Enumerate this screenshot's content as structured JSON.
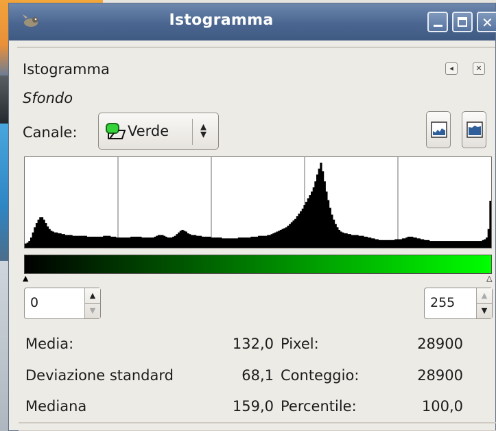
{
  "window": {
    "title": "Istogramma",
    "controls": {
      "minimize": "_",
      "maximize": "□",
      "close": "✕"
    }
  },
  "panel": {
    "title": "Istogramma",
    "layer_name": "Sfondo",
    "channel_label": "Canale:",
    "channel_value": "Verde",
    "channel_icon": "green-channel-icon",
    "mode_buttons": [
      "linear-histogram-icon",
      "logarithmic-histogram-icon"
    ]
  },
  "chart_data": {
    "type": "area",
    "x_range": [
      0,
      255
    ],
    "bins": 256,
    "values": [
      0.05,
      0.06,
      0.08,
      0.12,
      0.18,
      0.24,
      0.29,
      0.33,
      0.36,
      0.36,
      0.33,
      0.29,
      0.25,
      0.22,
      0.2,
      0.19,
      0.18,
      0.18,
      0.17,
      0.17,
      0.16,
      0.16,
      0.15,
      0.15,
      0.15,
      0.15,
      0.14,
      0.14,
      0.14,
      0.14,
      0.14,
      0.14,
      0.14,
      0.14,
      0.13,
      0.13,
      0.13,
      0.13,
      0.13,
      0.13,
      0.13,
      0.13,
      0.13,
      0.14,
      0.14,
      0.14,
      0.14,
      0.13,
      0.13,
      0.13,
      0.12,
      0.12,
      0.12,
      0.12,
      0.12,
      0.12,
      0.12,
      0.12,
      0.13,
      0.13,
      0.13,
      0.13,
      0.13,
      0.13,
      0.12,
      0.12,
      0.12,
      0.12,
      0.12,
      0.12,
      0.12,
      0.13,
      0.14,
      0.15,
      0.15,
      0.15,
      0.14,
      0.13,
      0.12,
      0.12,
      0.12,
      0.13,
      0.14,
      0.16,
      0.18,
      0.2,
      0.21,
      0.2,
      0.19,
      0.17,
      0.16,
      0.15,
      0.15,
      0.15,
      0.14,
      0.14,
      0.14,
      0.13,
      0.13,
      0.13,
      0.13,
      0.13,
      0.12,
      0.12,
      0.12,
      0.12,
      0.12,
      0.12,
      0.11,
      0.11,
      0.11,
      0.11,
      0.11,
      0.11,
      0.11,
      0.11,
      0.11,
      0.12,
      0.12,
      0.12,
      0.12,
      0.12,
      0.12,
      0.12,
      0.13,
      0.13,
      0.13,
      0.13,
      0.14,
      0.14,
      0.14,
      0.14,
      0.14,
      0.15,
      0.15,
      0.16,
      0.17,
      0.18,
      0.19,
      0.2,
      0.21,
      0.22,
      0.23,
      0.24,
      0.26,
      0.28,
      0.3,
      0.32,
      0.34,
      0.37,
      0.4,
      0.43,
      0.46,
      0.5,
      0.54,
      0.58,
      0.62,
      0.66,
      0.71,
      0.78,
      0.86,
      0.93,
      1.0,
      0.9,
      0.78,
      0.66,
      0.56,
      0.47,
      0.39,
      0.33,
      0.28,
      0.24,
      0.21,
      0.19,
      0.18,
      0.17,
      0.17,
      0.16,
      0.16,
      0.15,
      0.15,
      0.15,
      0.15,
      0.14,
      0.14,
      0.14,
      0.13,
      0.13,
      0.12,
      0.12,
      0.11,
      0.11,
      0.1,
      0.1,
      0.09,
      0.09,
      0.09,
      0.09,
      0.09,
      0.09,
      0.09,
      0.09,
      0.09,
      0.1,
      0.1,
      0.1,
      0.1,
      0.11,
      0.11,
      0.12,
      0.13,
      0.13,
      0.13,
      0.12,
      0.12,
      0.11,
      0.11,
      0.1,
      0.1,
      0.09,
      0.09,
      0.09,
      0.08,
      0.08,
      0.08,
      0.08,
      0.08,
      0.08,
      0.08,
      0.08,
      0.08,
      0.08,
      0.08,
      0.08,
      0.08,
      0.08,
      0.08,
      0.08,
      0.08,
      0.08,
      0.08,
      0.08,
      0.08,
      0.08,
      0.08,
      0.08,
      0.08,
      0.08,
      0.08,
      0.08,
      0.08,
      0.09,
      0.1,
      0.12,
      0.22,
      0.55
    ],
    "gradient_from": "#000000",
    "gradient_to": "#00ff00"
  },
  "range": {
    "low": "0",
    "high": "255"
  },
  "stats": {
    "mean_label": "Media:",
    "mean_value": "132,0",
    "std_label": "Deviazione standard",
    "std_value": "68,1",
    "median_label": "Mediana",
    "median_value": "159,0",
    "pixels_label": "Pixel:",
    "pixels_value": "28900",
    "count_label": "Conteggio:",
    "count_value": "28900",
    "percentile_label": "Percentile:",
    "percentile_value": "100,0"
  },
  "colors": {
    "accent_green": "#00ff00",
    "titlebar": "#4a6690"
  }
}
